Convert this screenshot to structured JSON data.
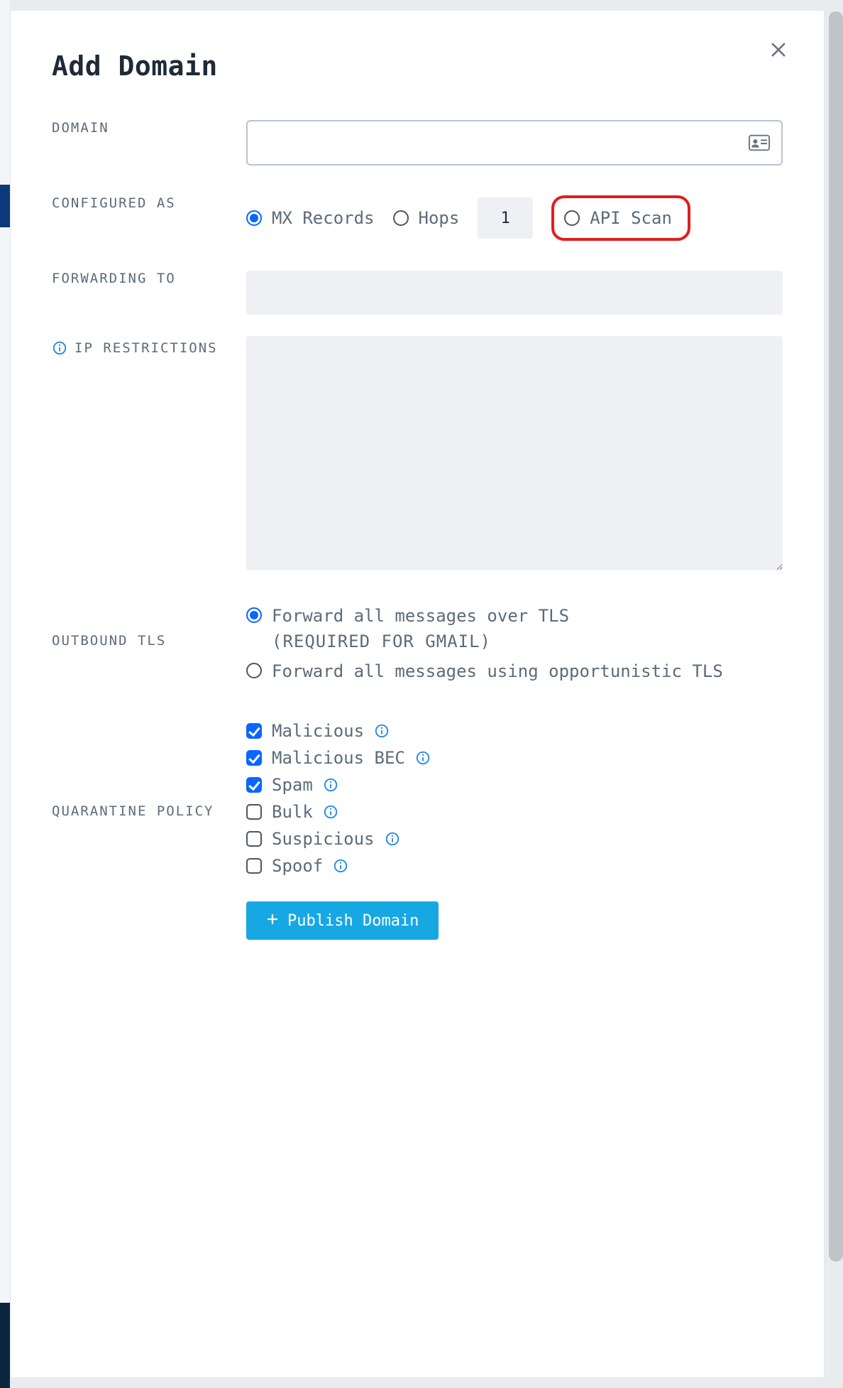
{
  "title": "Add Domain",
  "labels": {
    "domain": "DOMAIN",
    "configured_as": "CONFIGURED AS",
    "forwarding_to": "FORWARDING TO",
    "ip_restrictions": "IP RESTRICTIONS",
    "outbound_tls": "OUTBOUND TLS",
    "quarantine_policy": "QUARANTINE POLICY"
  },
  "domain": {
    "value": ""
  },
  "configured_as": {
    "mx_records": "MX Records",
    "hops": "Hops",
    "hops_value": "1",
    "api_scan": "API Scan",
    "selected": "mx_records"
  },
  "forwarding_to": {
    "value": ""
  },
  "ip_restrictions": {
    "value": ""
  },
  "outbound_tls": {
    "required": "Forward all messages over TLS",
    "required_note": "(REQUIRED FOR GMAIL)",
    "opportunistic": "Forward all messages using opportunistic TLS",
    "selected": "required"
  },
  "quarantine": {
    "items": [
      {
        "label": "Malicious",
        "checked": true
      },
      {
        "label": "Malicious BEC",
        "checked": true
      },
      {
        "label": "Spam",
        "checked": true
      },
      {
        "label": "Bulk",
        "checked": false
      },
      {
        "label": "Suspicious",
        "checked": false
      },
      {
        "label": "Spoof",
        "checked": false
      }
    ]
  },
  "publish_label": "Publish Domain"
}
